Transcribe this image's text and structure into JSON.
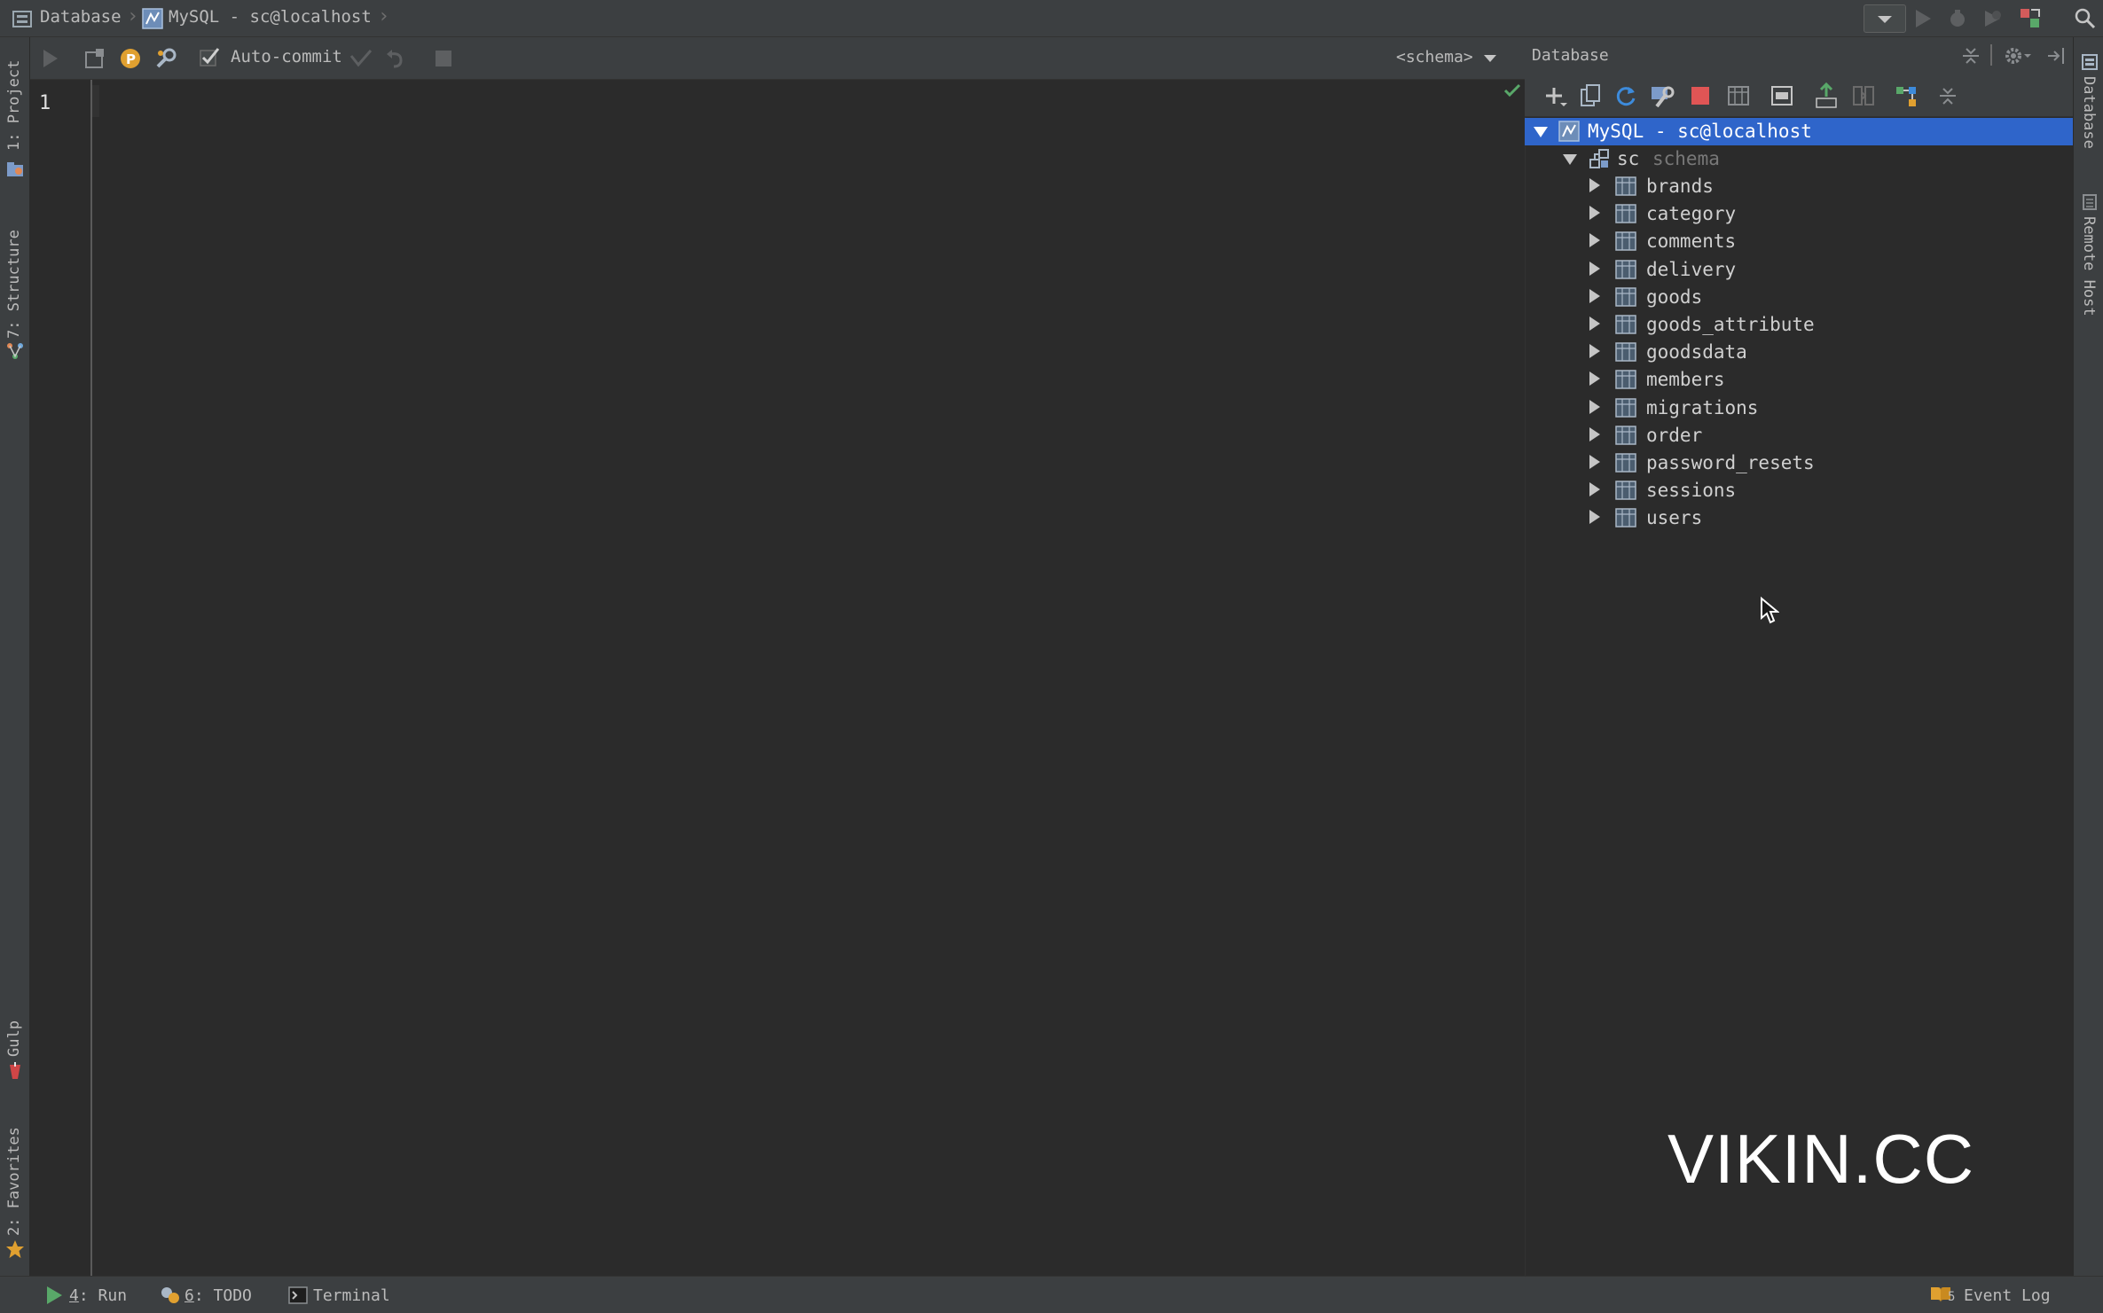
{
  "breadcrumb": {
    "items": [
      {
        "label": "Database",
        "icon": "database-icon"
      },
      {
        "label": "MySQL - sc@localhost",
        "icon": "mysql-icon"
      }
    ]
  },
  "left_tool_windows": [
    {
      "label": "1: Project",
      "icon": "project-icon"
    },
    {
      "label": "7: Structure",
      "icon": "structure-icon"
    },
    {
      "label": "Gulp",
      "icon": "gulp-icon"
    },
    {
      "label": "2: Favorites",
      "icon": "star-icon"
    }
  ],
  "right_tool_windows": [
    {
      "label": "Database",
      "icon": "database-icon"
    },
    {
      "label": "Remote Host",
      "icon": "remote-host-icon"
    }
  ],
  "editor_toolbar": {
    "auto_commit_label": "Auto-commit",
    "auto_commit_checked": true,
    "schema_selector": "<schema>"
  },
  "editor": {
    "line_numbers": [
      "1"
    ]
  },
  "database_panel": {
    "title": "Database",
    "connection": "MySQL - sc@localhost",
    "schema_name": "sc",
    "schema_kind": "schema",
    "tables": [
      "brands",
      "category",
      "comments",
      "delivery",
      "goods",
      "goods_attribute",
      "goodsdata",
      "members",
      "migrations",
      "order",
      "password_resets",
      "sessions",
      "users"
    ]
  },
  "status_bar": {
    "run_number": "4",
    "run_label": ": Run",
    "todo_number": "6",
    "todo_label": ": TODO",
    "terminal_label": "Terminal",
    "event_log_count": "5",
    "event_log_label": "Event Log"
  },
  "watermark": "VIKIN.CC",
  "colors": {
    "selection": "#2f65ca",
    "panel_bg": "#3c3f41",
    "editor_bg": "#2b2b2b",
    "run_green": "#59a869",
    "stop_red": "#e05555"
  }
}
